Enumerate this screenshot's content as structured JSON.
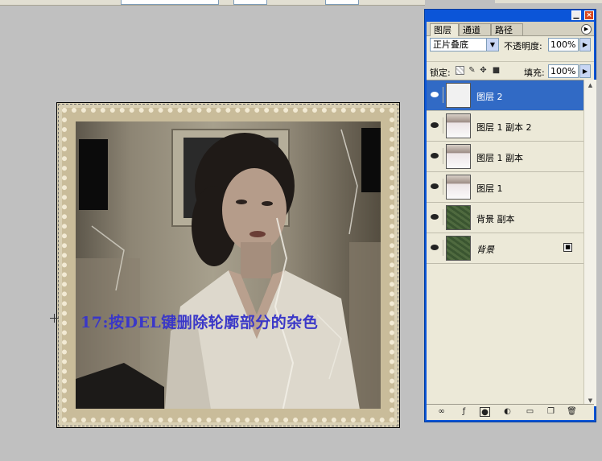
{
  "canvas": {
    "caption": "17:按DEL键删除轮廓部分的杂色"
  },
  "palette": {
    "tabs": [
      {
        "label": "图层"
      },
      {
        "label": "通道"
      },
      {
        "label": "路径"
      }
    ],
    "blend_mode": "正片叠底",
    "opacity_label": "不透明度:",
    "opacity_value": "100%",
    "lock_label": "锁定:",
    "fill_label": "填充:",
    "fill_value": "100%",
    "layers": [
      {
        "name": "图层 2",
        "selected": true,
        "thumb": "white"
      },
      {
        "name": "图层 1 副本 2",
        "selected": false,
        "thumb": "photo"
      },
      {
        "name": "图层 1 副本",
        "selected": false,
        "thumb": "photo"
      },
      {
        "name": "图层 1",
        "selected": false,
        "thumb": "photo"
      },
      {
        "name": "背景 副本",
        "selected": false,
        "thumb": "green"
      },
      {
        "name": "背景",
        "selected": false,
        "thumb": "green",
        "locked": true
      }
    ]
  },
  "colors": {
    "accent": "#316ac5",
    "titlebar": "#0b55d8",
    "caption_text": "#3a37c8",
    "workspace": "#c0c0c0"
  }
}
